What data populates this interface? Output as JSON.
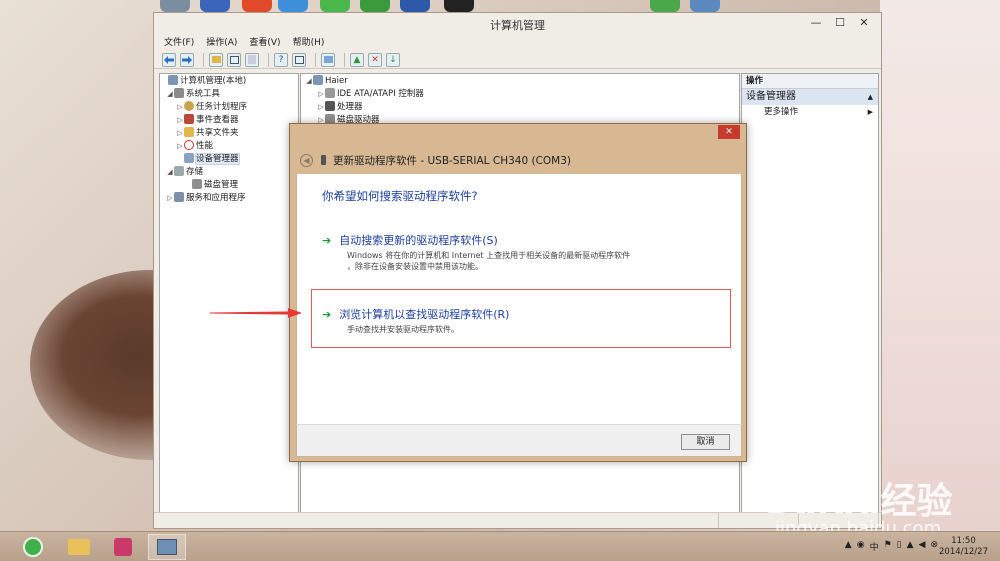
{
  "window": {
    "title": "计算机管理",
    "min_glyph": "—",
    "max_glyph": "☐",
    "close_glyph": "✕"
  },
  "menu": [
    "文件(F)",
    "操作(A)",
    "查看(V)",
    "帮助(H)"
  ],
  "tree": {
    "root": "计算机管理(本地)",
    "system_tools": "系统工具",
    "task_scheduler": "任务计划程序",
    "event_viewer": "事件查看器",
    "shared_folders": "共享文件夹",
    "performance": "性能",
    "device_manager": "设备管理器",
    "storage": "存储",
    "disk_management": "磁盘管理",
    "services_apps": "服务和应用程序"
  },
  "devices": {
    "computer": "Haier",
    "ide": "IDE ATA/ATAPI 控制器",
    "processor": "处理器",
    "disk": "磁盘驱动器"
  },
  "actions": {
    "header": "操作",
    "selected": "设备管理器",
    "more": "更多操作"
  },
  "dialog": {
    "title": "更新驱动程序软件 - USB-SERIAL CH340 (COM3)",
    "close_glyph": "✕",
    "question": "你希望如何搜索驱动程序软件?",
    "option1_title": "自动搜索更新的驱动程序软件(S)",
    "option1_desc_line1": "Windows 将在你的计算机和 Internet 上查找用于相关设备的最新驱动程序软件",
    "option1_desc_line2": "，除非在设备安装设置中禁用该功能。",
    "option2_title": "浏览计算机以查找驱动程序软件(R)",
    "option2_desc": "手动查找并安装驱动程序软件。",
    "cancel": "取消"
  },
  "taskbar": {
    "time": "11:50",
    "date": "2014/12/27"
  },
  "watermark": {
    "brand": "Baidu经验",
    "url": "jingyan.baidu.com"
  },
  "colors": {
    "accent_blue": "#1c3f9e",
    "green_arrow": "#1f9a3a",
    "highlight_red": "#e05a5a",
    "dialog_frame": "#d7b893",
    "close_red": "#c73a2e"
  }
}
